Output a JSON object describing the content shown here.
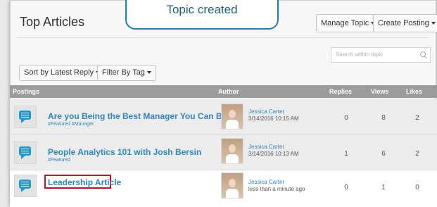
{
  "header": {
    "title": "Top Articles",
    "manage_topic": "Manage Topic",
    "create_posting": "Create Posting"
  },
  "toast": {
    "message": "Topic created"
  },
  "search": {
    "placeholder": "Search within topic"
  },
  "filters": {
    "sort_label": "Sort by Latest Reply",
    "filter_label": "Filter By Tag"
  },
  "table": {
    "columns": {
      "postings": "Postings",
      "author": "Author",
      "replies": "Replies",
      "views": "Views",
      "likes": "Likes"
    },
    "rows": [
      {
        "title": "Are you Being the Best Manager You Can Be?",
        "tags": "#Featured  #Manager",
        "author": "Jessica Carter",
        "date": "3/14/2016 10:15 AM",
        "replies": "0",
        "views": "8",
        "likes": "2"
      },
      {
        "title": "People Analytics 101 with Josh Bersin",
        "tags": "#Featured",
        "author": "Jessica Carter",
        "date": "3/14/2016 10:13 AM",
        "replies": "1",
        "views": "6",
        "likes": "2"
      },
      {
        "title": "Leadership Article",
        "tags": "",
        "author": "Jessica Carter",
        "date": "less than a minute ago",
        "replies": "0",
        "views": "1",
        "likes": "0"
      }
    ]
  },
  "colors": {
    "link": "#2d86c3",
    "highlight_border": "#d9091a",
    "toast_border": "#1f7fb3",
    "chat_icon": "#1b9bd6"
  }
}
